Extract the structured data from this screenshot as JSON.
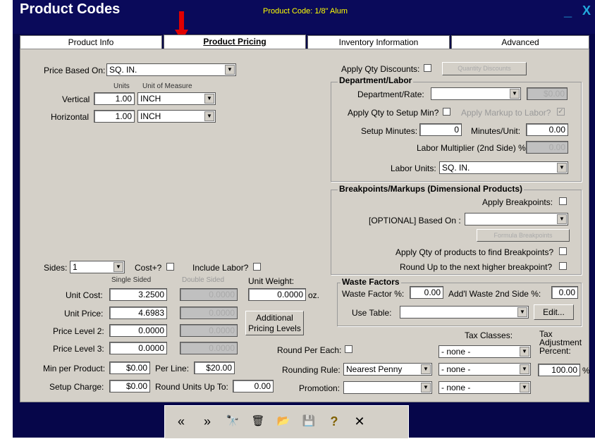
{
  "window": {
    "title": "Product Codes",
    "subtitle": "Product Code: 1/8\" Alum",
    "minimize": "_",
    "close": "X"
  },
  "tabs": [
    "Product Info",
    "Product Pricing",
    "Inventory Information",
    "Advanced"
  ],
  "pricing": {
    "price_based_on_label": "Price Based On:",
    "price_based_on_value": "SQ. IN.",
    "units_header": "Units",
    "uom_header": "Unit of Measure",
    "vertical_label": "Vertical",
    "vertical_units": "1.00",
    "vertical_uom": "INCH",
    "horizontal_label": "Horizontal",
    "horizontal_units": "1.00",
    "horizontal_uom": "INCH",
    "sides_label": "Sides:",
    "sides_value": "1",
    "cost_plus_label": "Cost+?",
    "include_labor_label": "Include Labor?",
    "single_sided_header": "Single Sided",
    "double_sided_header": "Double Sided",
    "unit_weight_label": "Unit Weight:",
    "unit_weight_value": "0.0000",
    "unit_weight_unit": "oz.",
    "unit_cost_label": "Unit Cost:",
    "unit_cost_single": "3.2500",
    "unit_cost_double": "0.0000",
    "unit_price_label": "Unit Price:",
    "unit_price_single": "4.6983",
    "unit_price_double": "0.0000",
    "price_level2_label": "Price Level 2:",
    "price_level2_single": "0.0000",
    "price_level2_double": "0.0000",
    "price_level3_label": "Price Level 3:",
    "price_level3_single": "0.0000",
    "price_level3_double": "0.0000",
    "additional_pricing_line1": "Additional",
    "additional_pricing_line2": "Pricing Levels",
    "min_per_product_label": "Min per Product:",
    "min_per_product_value": "$0.00",
    "per_line_label": "Per Line:",
    "per_line_value": "$20.00",
    "setup_charge_label": "Setup Charge:",
    "setup_charge_value": "$0.00",
    "round_units_label": "Round Units Up To:",
    "round_units_value": "0.00",
    "round_per_each_label": "Round Per Each:",
    "rounding_rule_label": "Rounding Rule:",
    "rounding_rule_value": "Nearest Penny",
    "promotion_label": "Promotion:",
    "promotion_value": ""
  },
  "qty": {
    "apply_qty_discounts_label": "Apply Qty Discounts:",
    "quantity_discounts_button": "Quantity Discounts"
  },
  "labor": {
    "group_title": "Department/Labor",
    "dept_rate_label": "Department/Rate:",
    "dept_rate_value": "",
    "dept_rate_amount": "$0.00",
    "apply_qty_setup_label": "Apply Qty to Setup Min?",
    "apply_markup_label": "Apply Markup to Labor?",
    "setup_minutes_label": "Setup Minutes:",
    "setup_minutes_value": "0",
    "minutes_unit_label": "Minutes/Unit:",
    "minutes_unit_value": "0.00",
    "labor_multiplier_label": "Labor Multiplier (2nd Side) %:",
    "labor_multiplier_value": "0.00",
    "labor_units_label": "Labor Units:",
    "labor_units_value": "SQ. IN."
  },
  "breakpoints": {
    "group_title": "Breakpoints/Markups (Dimensional Products)",
    "apply_breakpoints_label": "Apply Breakpoints:",
    "based_on_label": "[OPTIONAL] Based On :",
    "based_on_value": "",
    "formula_button": "Formula Breakpoints",
    "apply_qty_label": "Apply Qty of products to find Breakpoints?",
    "round_up_label": "Round Up to the next higher breakpoint?"
  },
  "waste": {
    "group_title": "Waste Factors",
    "waste_factor_label": "Waste Factor %:",
    "waste_factor_value": "0.00",
    "addl_waste_label": "Add'l Waste 2nd Side %:",
    "addl_waste_value": "0.00",
    "use_table_label": "Use Table:",
    "use_table_value": "",
    "edit_button": "Edit..."
  },
  "tax": {
    "tax_classes_label": "Tax Classes:",
    "tax_adj_label_1": "Tax",
    "tax_adj_label_2": "Adjustment",
    "tax_adj_label_3": "Percent:",
    "tax_class_1": "- none -",
    "tax_class_2": "- none -",
    "tax_class_3": "- none -",
    "tax_adj_value": "100.00",
    "tax_adj_unit": "%"
  },
  "toolbar": {
    "first": "«",
    "last": "»",
    "find": "🔭",
    "delete": "🗑",
    "open": "📂",
    "save": "💾",
    "help": "?",
    "close": "✕"
  }
}
